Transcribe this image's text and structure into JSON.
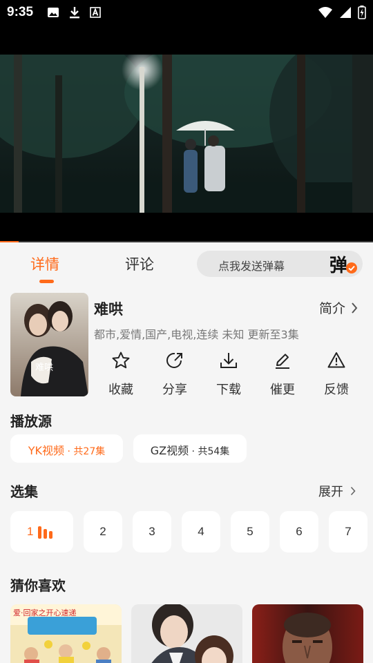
{
  "status_bar": {
    "time": "9:35",
    "icons": [
      "image-icon",
      "download-icon",
      "font-a-icon",
      "wifi-icon",
      "signal-icon",
      "battery-charging-icon"
    ]
  },
  "video": {
    "progress_fraction": 0.05
  },
  "tabs": {
    "details": "详情",
    "comments": "评论",
    "active": "details"
  },
  "danmaku": {
    "placeholder": "点我发送弹幕",
    "button_char": "弹",
    "accent_color": "#ff6a1a"
  },
  "show": {
    "title": "难哄",
    "synopsis_label": "简介",
    "meta": "都市,爱情,国产,电视,连续 未知 更新至3集",
    "poster_text": "难哄"
  },
  "actions": [
    {
      "label": "收藏",
      "icon": "star-icon"
    },
    {
      "label": "分享",
      "icon": "share-icon"
    },
    {
      "label": "下载",
      "icon": "download-icon"
    },
    {
      "label": "催更",
      "icon": "pencil-icon"
    },
    {
      "label": "反馈",
      "icon": "warning-icon"
    }
  ],
  "sources": {
    "title": "播放源",
    "items": [
      {
        "name": "YK视频",
        "count": "共27集",
        "active": true
      },
      {
        "name": "GZ视频",
        "count": "共54集",
        "active": false
      }
    ]
  },
  "episodes": {
    "title": "选集",
    "expand_label": "展开",
    "items": [
      "1",
      "2",
      "3",
      "4",
      "5",
      "6",
      "7"
    ],
    "active": "1"
  },
  "recommendations": {
    "title": "猜你喜欢",
    "items": [
      {
        "poster_text": "爱·回家之开心速递"
      },
      {
        "poster_text": ""
      },
      {
        "poster_text": ""
      }
    ]
  },
  "colors": {
    "accent": "#ff6a1a",
    "background": "#f5f5f5",
    "card": "#ffffff"
  }
}
